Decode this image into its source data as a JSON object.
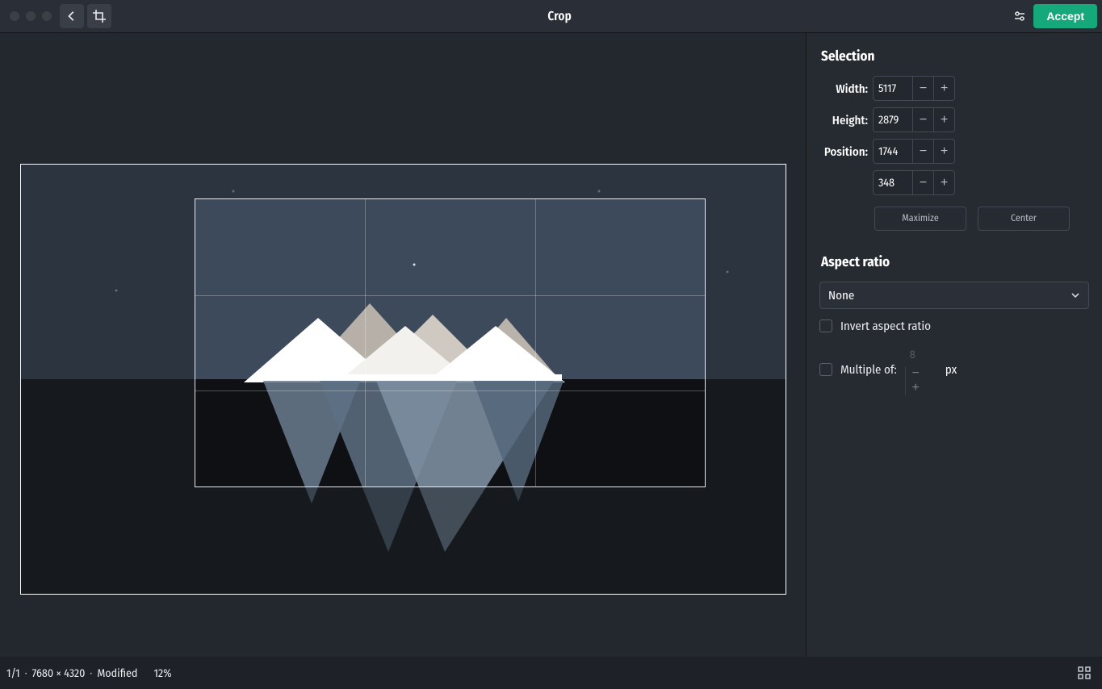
{
  "titlebar": {
    "title": "Crop",
    "accept_label": "Accept"
  },
  "sidebar": {
    "selection_title": "Selection",
    "width_label": "Width:",
    "height_label": "Height:",
    "position_label": "Position:",
    "width_value": "5117",
    "height_value": "2879",
    "pos_x_value": "1744",
    "pos_y_value": "348",
    "maximize_label": "Maximize",
    "center_label": "Center",
    "aspect_title": "Aspect ratio",
    "aspect_value": "None",
    "invert_label": "Invert aspect ratio",
    "multiple_label": "Multiple of:",
    "multiple_value": "8",
    "multiple_unit": "px"
  },
  "footer": {
    "index": "1/1",
    "dims": "7680 × 4320",
    "status": "Modified",
    "zoom": "12%"
  }
}
